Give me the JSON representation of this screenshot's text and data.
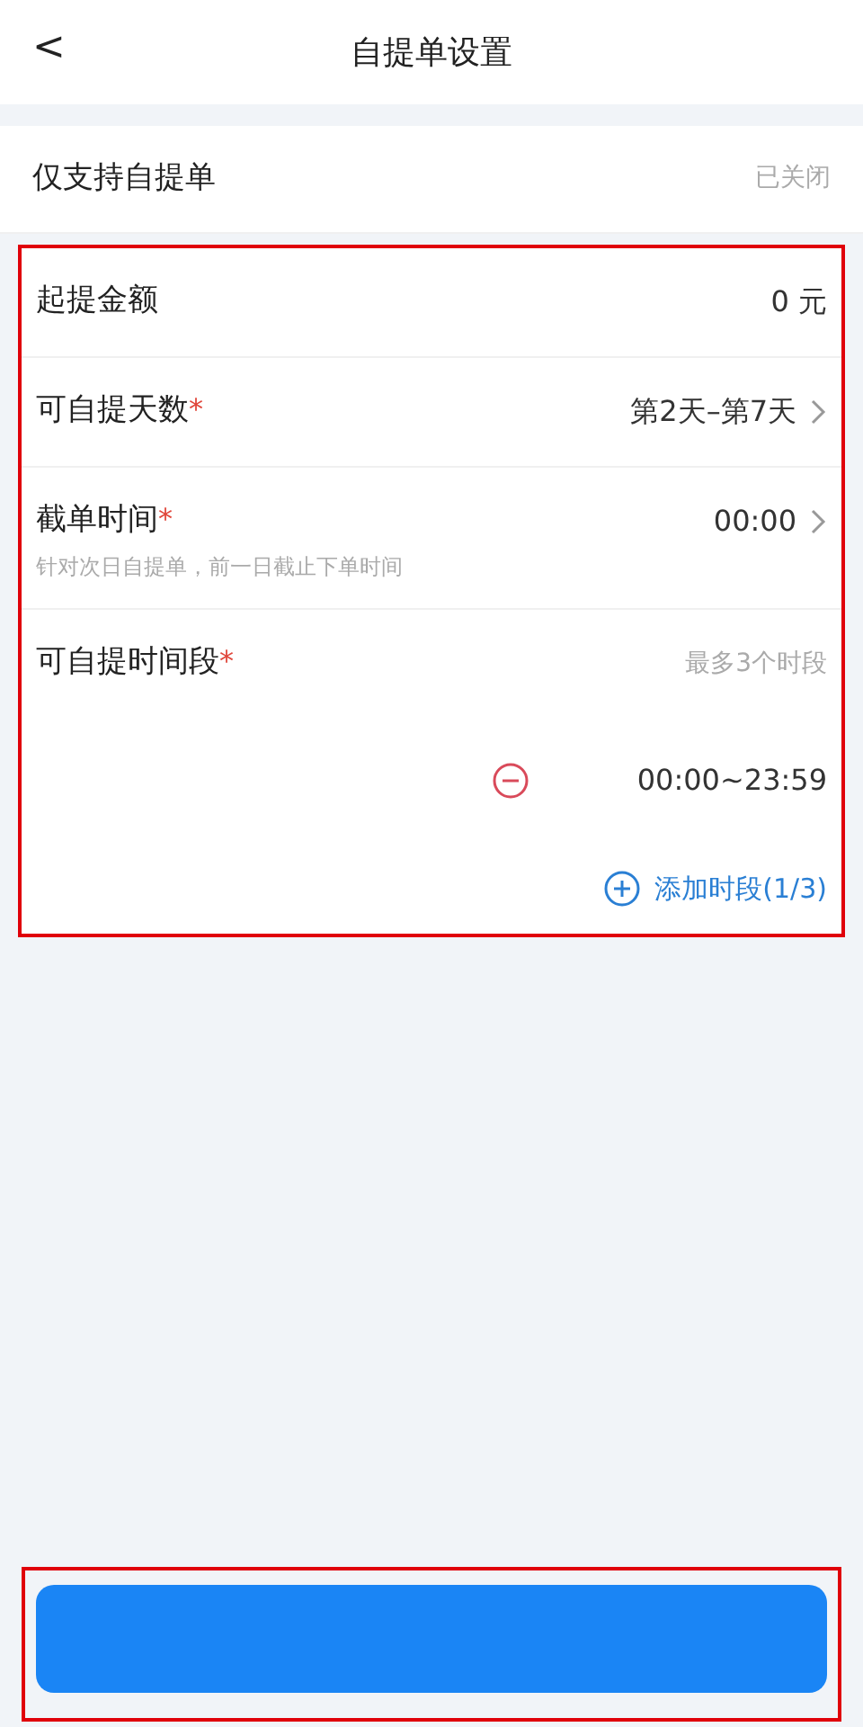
{
  "header": {
    "back": "<",
    "title": "自提单设置"
  },
  "pickup_only": {
    "label": "仅支持自提单",
    "value": "已关闭"
  },
  "settings": [
    {
      "kind": "value",
      "label": "起提金额",
      "value": "0 元"
    },
    {
      "kind": "link",
      "label": "可自提天数",
      "required_mark": "*",
      "value": "第2天–第7天"
    },
    {
      "kind": "link",
      "label": "截单时间",
      "required_mark": "*",
      "value": "00:00",
      "hint": "针对次日自提单，前一日截止下单时间"
    },
    {
      "kind": "slots",
      "label": "可自提时间段",
      "required_mark": "*",
      "note": "最多3个时段",
      "slots": [
        "00:00~23:59"
      ],
      "add": "添加时段(1/3)"
    }
  ]
}
